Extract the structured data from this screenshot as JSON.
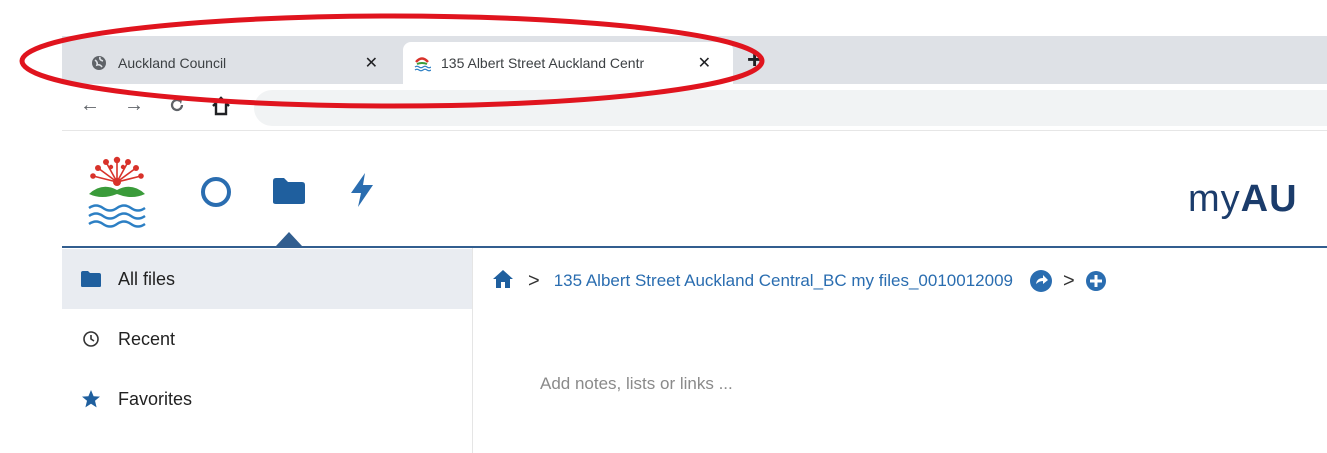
{
  "browser": {
    "tabs": [
      {
        "title": "Auckland Council",
        "active": false,
        "favicon": "globe-icon"
      },
      {
        "title": "135 Albert Street Auckland Centr",
        "active": true,
        "favicon": "auckland-council-logo-icon"
      }
    ],
    "close_glyph": "✕",
    "newtab_glyph": "+"
  },
  "app": {
    "brand_prefix": "my",
    "brand_bold": "AU",
    "nav": [
      "circle-icon",
      "folder-icon",
      "lightning-icon"
    ],
    "accent": "#2a6db0",
    "header_line_color": "#325e8f"
  },
  "sidebar": {
    "items": [
      {
        "label": "All files",
        "icon": "folder-icon",
        "active": true
      },
      {
        "label": "Recent",
        "icon": "clock-icon",
        "active": false
      },
      {
        "label": "Favorites",
        "icon": "star-icon",
        "active": false
      }
    ]
  },
  "breadcrumb": {
    "path_label": "135 Albert Street Auckland Central_BC my files_0010012009",
    "separator": ">"
  },
  "main": {
    "notes_placeholder": "Add notes, lists or links ..."
  },
  "annotation": {
    "color": "#e0141e"
  }
}
